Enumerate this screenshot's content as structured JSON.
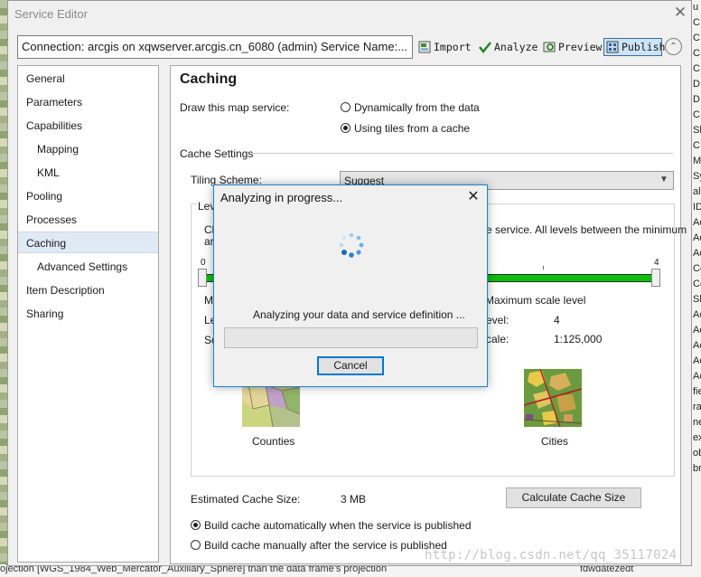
{
  "window": {
    "title": "Service Editor",
    "close_glyph": "✕"
  },
  "toolbar": {
    "connection_text": "Connection: arcgis on xqwserver.arcgis.cn_6080 (admin)   Service Name:...",
    "import_label": "Import",
    "analyze_label": "Analyze",
    "preview_label": "Preview",
    "publish_label": "Publish",
    "collapse_glyph": "⌃"
  },
  "sidebar": {
    "items": [
      {
        "label": "General"
      },
      {
        "label": "Parameters"
      },
      {
        "label": "Capabilities"
      },
      {
        "label": "Mapping"
      },
      {
        "label": "KML"
      },
      {
        "label": "Pooling"
      },
      {
        "label": "Processes"
      },
      {
        "label": "Caching"
      },
      {
        "label": "Advanced Settings"
      },
      {
        "label": "Item Description"
      },
      {
        "label": "Sharing"
      }
    ],
    "selected": "Caching"
  },
  "main": {
    "title": "Caching",
    "draw_label": "Draw this map service:",
    "draw_options": [
      {
        "label": "Dynamically from the data",
        "selected": false
      },
      {
        "label": "Using tiles from a cache",
        "selected": true
      }
    ],
    "cache_settings_label": "Cache Settings",
    "tiling_scheme_label": "Tiling Scheme:",
    "tiling_scheme_value": "Suggest",
    "levels_group_label": "Lev",
    "levels_desc_start": "Ch",
    "levels_desc_start2": "ar",
    "levels_desc_end": "e service. All levels between the minimum",
    "slider_min_tick": "0",
    "slider_max_tick": "4",
    "slider_min_fraction": 0.0,
    "slider_max_fraction": 1.0,
    "min_scale_label_start": "Mi",
    "level_label_start": "Le",
    "scale_label_start": "Sc",
    "max_scale_label": "Maximum scale level",
    "max_level_label_end": "evel:",
    "max_level_value": "4",
    "max_scale_label_end": "cale:",
    "max_scale_value": "1:125,000",
    "min_map_label": "Counties",
    "max_map_label": "Cities",
    "estimated_size_label": "Estimated Cache Size:",
    "estimated_size_value": "3 MB",
    "calculate_button": "Calculate Cache Size",
    "build_options": [
      {
        "label": "Build cache automatically when the service is published",
        "selected": true
      },
      {
        "label": "Build cache manually after the service is published",
        "selected": false
      }
    ]
  },
  "dialog": {
    "title": "Analyzing in progress...",
    "close_glyph": "✕",
    "message": "Analyzing your data and service definition ...",
    "progress": 0,
    "cancel_label": "Cancel"
  },
  "background": {
    "right_strip": [
      "u",
      "C:",
      "C:",
      "C:",
      "C:",
      "D",
      "D",
      "C:",
      "Sh",
      "C:",
      "M",
      "Sy",
      "al",
      "ID",
      "Ac",
      "Ac",
      "Ac",
      "Cc",
      "Cc",
      "Sh",
      "Ac",
      "Ac",
      "Ac",
      "Ac",
      "Ac",
      "fie",
      "ra",
      "ne",
      "ex",
      "ob",
      "br"
    ],
    "bottom_text": "ojection [WGS_1984_Web_Mercator_Auxiliary_Sphere] than the data frame's projection",
    "bottom_text2": "fdwdatezedt",
    "watermark": "http://blog.csdn.net/qq_35117024"
  },
  "colors": {
    "slider_fill": "#0cc00c",
    "dialog_border": "#1883d7",
    "selection": "#e0eaf5"
  }
}
